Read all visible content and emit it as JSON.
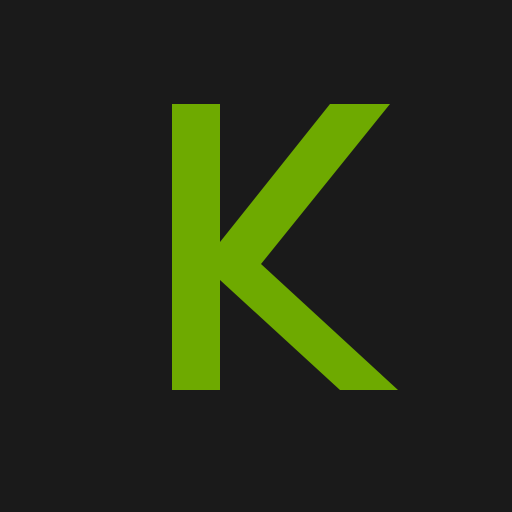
{
  "logo": {
    "letter": "K",
    "icon": "letter-k-logo-icon",
    "background_color": "#1a1a1a",
    "letter_color": "#6eaa00"
  }
}
